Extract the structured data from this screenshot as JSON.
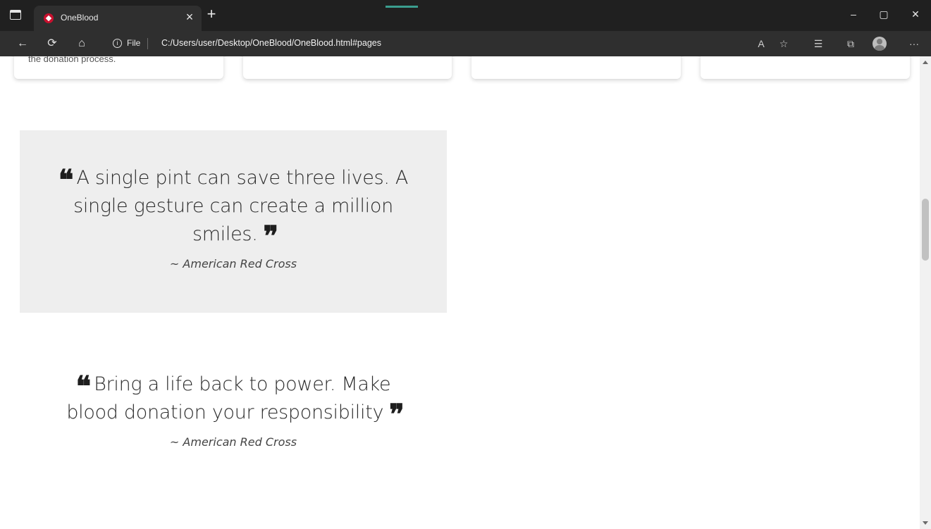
{
  "browser": {
    "tab_title": "OneBlood",
    "tab_close": "×",
    "new_tab": "+",
    "file_label": "File",
    "url": "C:/Users/user/Desktop/OneBlood/OneBlood.html#pages",
    "window_controls": {
      "minimize": "–",
      "restore": "▢",
      "close": "✕"
    },
    "nav": {
      "back": "←",
      "refresh": "⟳",
      "home": "⌂"
    },
    "toolbar": {
      "read_aloud": "A",
      "add_favorite": "☆",
      "favorites": "☰",
      "collections": "⧉",
      "more": "···"
    },
    "accent_color": "#c8102e"
  },
  "cards": [
    {
      "text": "the donation process."
    },
    {
      "text": ""
    },
    {
      "text": ""
    },
    {
      "text": ""
    }
  ],
  "quotes": [
    {
      "text": "A single pint can save three lives. A single gesture can create a million smiles.",
      "author": "~ American Red Cross",
      "shaded": true
    },
    {
      "text": "Bring a life back to power. Make blood donation your responsibility",
      "author": "~ American Red Cross",
      "shaded": false
    }
  ],
  "quote_marks": {
    "open": "❝",
    "close": "❞"
  }
}
